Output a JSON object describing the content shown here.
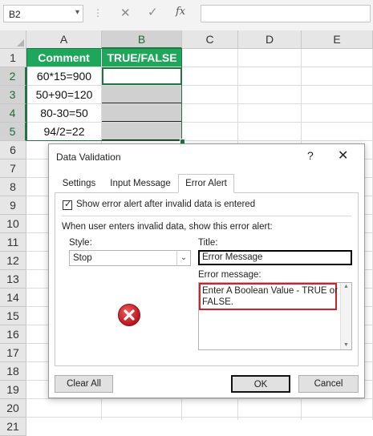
{
  "formula_bar": {
    "name_box": "B2",
    "name_box_arrow": "▾",
    "dots": "⋮",
    "cancel": "✕",
    "enter": "✓",
    "fx": "fx",
    "formula": ""
  },
  "columns": [
    "A",
    "B",
    "C",
    "D",
    "E"
  ],
  "rows": [
    "1",
    "2",
    "3",
    "4",
    "5",
    "6",
    "7",
    "8",
    "9",
    "10",
    "11",
    "12",
    "13",
    "14",
    "15",
    "16",
    "17",
    "18",
    "19",
    "20",
    "21"
  ],
  "table": {
    "headers": [
      "Comment",
      "TRUE/FALSE"
    ],
    "comments": [
      "60*15=900",
      "50+90=120",
      "80-30=50",
      "94/2=22"
    ],
    "results": [
      "",
      "",
      "",
      ""
    ]
  },
  "colors": {
    "header_green": "#1ea75a",
    "selected_cells": "#d0d0d0",
    "excel_green": "#217346",
    "highlight_red": "#d3202a"
  },
  "dialog": {
    "title": "Data Validation",
    "help": "?",
    "close": "✕",
    "tabs": [
      "Settings",
      "Input Message",
      "Error Alert"
    ],
    "active_tab": "Error Alert",
    "show_alert_checkbox": {
      "checked": true,
      "label_pre": "Show error alert after invalid data is entered",
      "mark": "✓"
    },
    "when_label": "When user enters invalid data, show this error alert:",
    "style_label": "Style:",
    "style_value": "Stop",
    "style_arrow": "⌄",
    "icon": "stop-error-icon",
    "title_label": "Title:",
    "title_value": "Error Message",
    "error_message_label": "Error message:",
    "error_message_value": "Enter A Boolean Value - TRUE or\nFALSE.",
    "scroll_up": "▲",
    "scroll_down": "▼",
    "buttons": {
      "clear_all": "Clear All",
      "ok": "OK",
      "cancel": "Cancel"
    }
  }
}
